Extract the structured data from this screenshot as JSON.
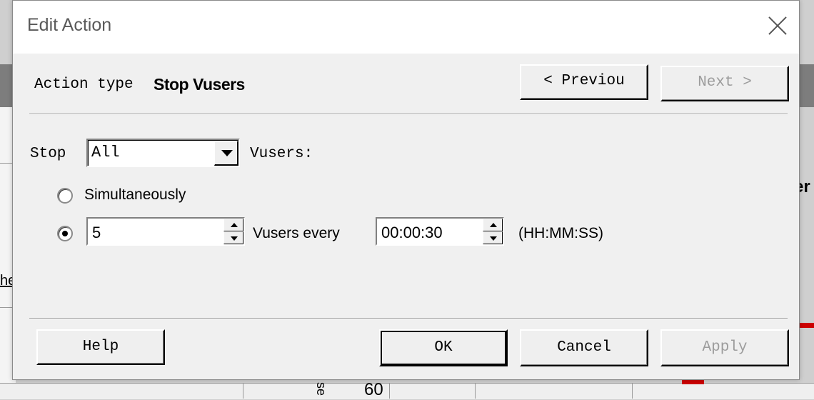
{
  "background": {
    "partial_link": "he",
    "partial_heading": "er",
    "axis_value": "60",
    "axis_label": "se"
  },
  "dialog": {
    "title": "Edit Action",
    "action_type_label": "Action type",
    "action_type_value": "Stop Vusers",
    "previous_label": "< Previou",
    "next_label": "Next >",
    "stop_label": "Stop",
    "stop_selected": "All",
    "vusers_label": "Vusers:",
    "option_simultaneously": "Simultaneously",
    "vusers_count": "5",
    "vusers_every_label": "Vusers every",
    "interval": "00:00:30",
    "interval_format": "(HH:MM:SS)",
    "selected_option": "gradual",
    "help_label": "Help",
    "ok_label": "OK",
    "cancel_label": "Cancel",
    "apply_label": "Apply"
  }
}
